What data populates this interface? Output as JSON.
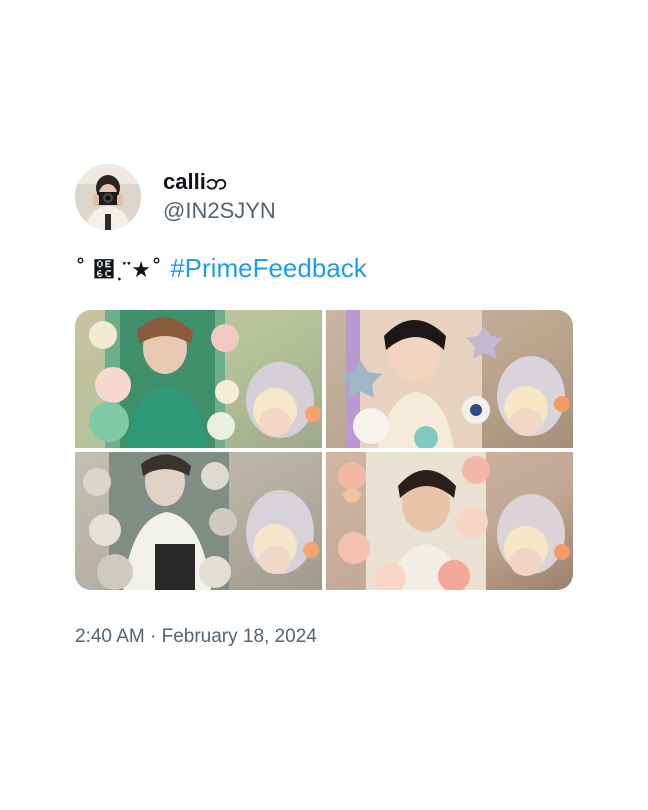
{
  "tweet": {
    "author": {
      "display_name": "calliဘ",
      "handle": "@IN2SJYN",
      "avatar": "avatar-photo-camera"
    },
    "text": {
      "decoration": "˚ ๬ ฺ་་★˚",
      "hashtag": "#PrimeFeedback"
    },
    "media": [
      {
        "icon": "photo-pastel-frame-mint-roses"
      },
      {
        "icon": "photo-pastel-frame-stars-plush"
      },
      {
        "icon": "photo-pastel-frame-crystal"
      },
      {
        "icon": "photo-pastel-frame-peach-roses"
      }
    ],
    "timestamp": {
      "time": "2:40 AM",
      "separator": "·",
      "date": "February 18, 2024"
    }
  },
  "colors": {
    "text_primary": "#0f1419",
    "text_secondary": "#536471",
    "link": "#1d9bf0",
    "background": "#ffffff"
  }
}
